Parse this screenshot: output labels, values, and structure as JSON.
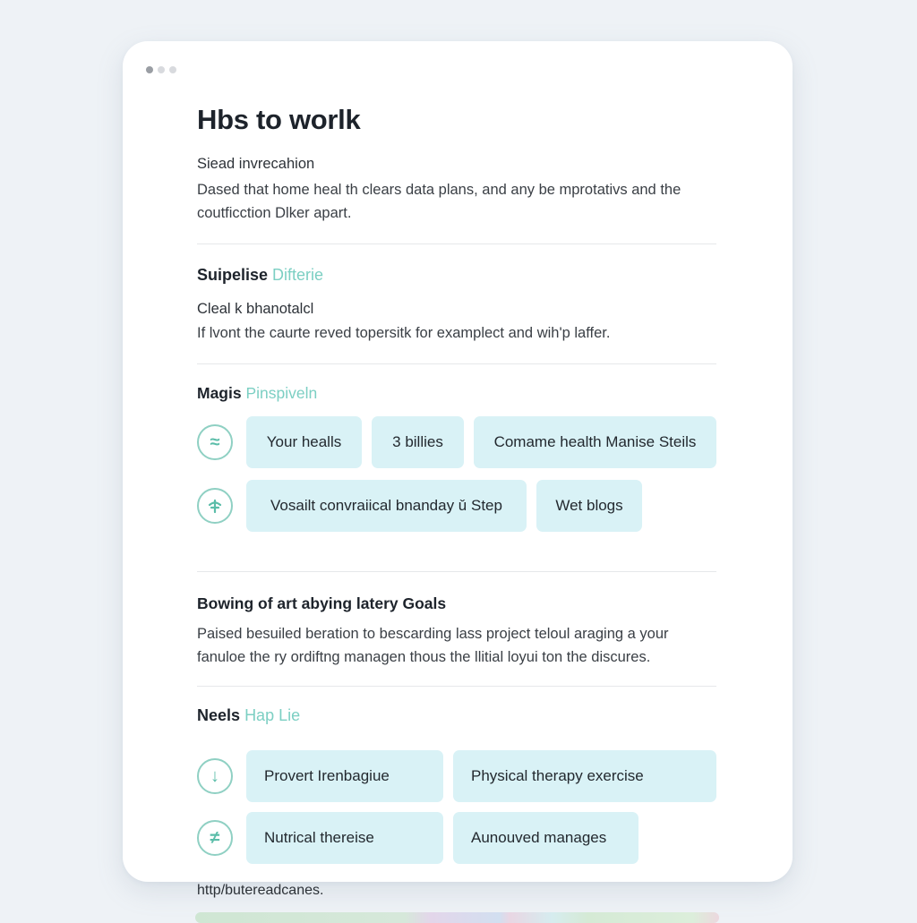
{
  "window": {
    "dots": [
      "window-dot-1",
      "window-dot-2",
      "window-dot-3"
    ]
  },
  "header": {
    "title": "Hbs to worlk",
    "subtitle": "Siead invrecahion",
    "paragraph_line1": "Dased that home heal th clears data plans, and any be mprotativs and the",
    "paragraph_line2": "coutficction Dlker apart."
  },
  "section1": {
    "heading_main": "Suipelise",
    "heading_accent": "Difterie",
    "subtitle": "Cleal k bhanotalcl",
    "paragraph": "If lvont the caurte reved topersitk for examplect and wih'p laffer."
  },
  "section2": {
    "heading_main": "Magis",
    "heading_accent": "Pinspiveln",
    "rows": [
      {
        "icon": "swap-arrow-icon",
        "icon_glyph": "≈",
        "chips": [
          "Your healls",
          "3 billies",
          "Comame health Manise Steils"
        ]
      },
      {
        "icon": "plant-icon",
        "icon_glyph": "⸸",
        "chips": [
          "Vosailt convraiical bnanday ǔ Step",
          "Wet blogs"
        ]
      }
    ]
  },
  "section3": {
    "heading": "Bowing of art abying latery Goals",
    "paragraph_line1": "Paised besuiled beration to bescarding lass project teloul araging a your",
    "paragraph_line2": "fanuloe the ry ordiftng managen thous the llitial loyui ton the discures."
  },
  "section4": {
    "heading_main": "Neels",
    "heading_accent": "Hap Lie",
    "rows": [
      {
        "icon": "down-arrow-icon",
        "icon_glyph": "↓",
        "chips": [
          "Provert Irenbagiue",
          "Physical therapy exercise"
        ]
      },
      {
        "icon": "not-equal-icon",
        "icon_glyph": "≠",
        "chips": [
          "Nutrical thereise",
          "Aunouved manages"
        ]
      }
    ]
  },
  "footer": {
    "link": "http/butereadcanes."
  },
  "colors": {
    "accent": "#7ccfc3",
    "chip_bg": "#d9f2f6",
    "background": "#eef2f6",
    "card": "#ffffff"
  }
}
